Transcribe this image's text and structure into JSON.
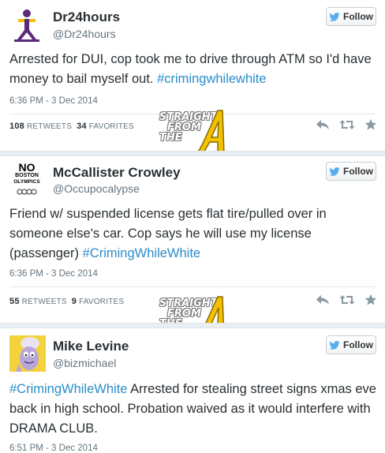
{
  "tweets": [
    {
      "name": "Dr24hours",
      "handle": "@Dr24hours",
      "follow_label": "Follow",
      "text_plain": "Arrested for DUI, cop took me to drive through ATM so I'd have money to bail myself out. ",
      "hashtag": "#crimingwhilewhite",
      "text_after": "",
      "timestamp": "6:36 PM - 3 Dec 2014",
      "retweets": "108",
      "retweets_label": "RETWEETS",
      "favorites": "34",
      "favorites_label": "FAVORITES",
      "avatar_icon": "stick-figure-logo-icon"
    },
    {
      "name": "McCallister Crowley",
      "handle": "@Occupocalypse",
      "follow_label": "Follow",
      "text_plain": "Friend w/ suspended license gets flat tire/pulled over in someone else's car. Cop says he will use my license (passenger) ",
      "hashtag": "#CrimingWhileWhite",
      "text_after": "",
      "timestamp": "6:36 PM - 3 Dec 2014",
      "retweets": "55",
      "retweets_label": "RETWEETS",
      "favorites": "9",
      "favorites_label": "FAVORITES",
      "avatar_text_top": "NO",
      "avatar_text_mid": "BOSTON",
      "avatar_text_bot": "OLYMPICS"
    },
    {
      "name": "Mike Levine",
      "handle": "@bizmichael",
      "follow_label": "Follow",
      "hashtag": "#CrimingWhileWhite",
      "text_after": " Arrested for stealing street signs xmas eve back in high school. Probation waived as it would interfere with DRAMA CLUB.",
      "timestamp": "6:51 PM - 3 Dec 2014",
      "avatar_icon": "cartoon-character-icon"
    }
  ],
  "watermark": {
    "line1": "STRAIGHT",
    "line2": "FROM",
    "line3": "THE",
    "letter": "A"
  },
  "colors": {
    "link": "#2a8dc9",
    "twitter_blue": "#55acee",
    "separator": "#e8eef2",
    "watermark_gold": "#f2c200"
  }
}
